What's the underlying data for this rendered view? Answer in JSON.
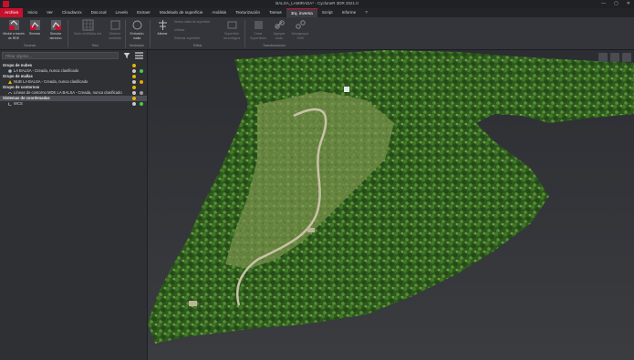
{
  "window": {
    "title": "BALSA_LAMIRADA* - CycloneR 3DR 2021.0",
    "controls": [
      "—",
      "▢",
      "✕"
    ]
  },
  "menu": {
    "tabs": [
      "Archivo",
      "Inicio",
      "Ver",
      "Cloudworx",
      "Dat.ocal",
      "Levelo",
      "Extraer",
      "Modelado de superficie",
      "Análisis",
      "Texturización",
      "Tareas",
      "3rq. inversa",
      "Script",
      "Informe",
      "?"
    ],
    "active_index": 11
  },
  "ribbon": {
    "buttons": [
      {
        "label1": "Modal a través",
        "label2": "de RDE"
      },
      {
        "label1": "Simular",
        "label2": ""
      },
      {
        "label1": "Simular",
        "label2": "derecho"
      },
      {
        "label1": "Subir red/Malla red",
        "label2": ""
      },
      {
        "label1": "Obtener",
        "label2": "medidas"
      },
      {
        "label1": "Extrusión",
        "label2": "malla"
      },
      {
        "label1": "Alinear",
        "label2": ""
      },
      {
        "label1": "Superficie",
        "label2": "tecnológica"
      },
      {
        "label1": "Crear",
        "label2": "Superficies"
      },
      {
        "label1": "Agrupar",
        "label2": "rutas"
      },
      {
        "label1": "Desagrupar",
        "label2": "Shift"
      }
    ],
    "small_items": [
      "Nueva malla de superficie",
      "Unificar",
      "Rellenar superficie"
    ],
    "groups": [
      "Generar",
      "Red",
      "Modelado",
      "Editar",
      "Transformación"
    ]
  },
  "panel": {
    "search_placeholder": "Filtrar objetos...",
    "tree": [
      {
        "text": "Grupo de nubes",
        "level": 0,
        "group": true
      },
      {
        "text": "LA BALSA - Creada, nunca clasificado",
        "level": 1,
        "group": false
      },
      {
        "text": "Grupo de mallas",
        "level": 0,
        "group": true
      },
      {
        "text": "NUB LA BALSA - Creada, nunca clasificado",
        "level": 1,
        "group": false
      },
      {
        "text": "Grupo de contornos",
        "level": 0,
        "group": true
      },
      {
        "text": "Líneas de contorno MDE LA BALSA - Creada, nunca clasificado",
        "level": 1,
        "group": false
      },
      {
        "text": "Sistemas de coordenadas",
        "level": 0,
        "group": true,
        "selected": true
      },
      {
        "text": "WCS",
        "level": 1,
        "group": false
      }
    ]
  },
  "colors": {
    "accent": "#c8102e",
    "panel_bg": "#2e3034",
    "viewport_bg": "#35373b"
  }
}
